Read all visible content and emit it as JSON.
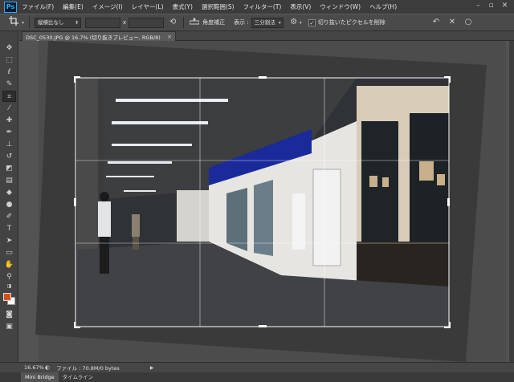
{
  "app": {
    "logo": "Ps"
  },
  "menu": [
    "ファイル(F)",
    "編集(E)",
    "イメージ(I)",
    "レイヤー(L)",
    "書式(Y)",
    "選択範囲(S)",
    "フィルター(T)",
    "表示(V)",
    "ウィンドウ(W)",
    "ヘルプ(H)"
  ],
  "window_controls": {
    "minimize": "–",
    "restore": "▫",
    "close": "✕"
  },
  "options": {
    "ratio_select": "縦横比なし",
    "swap_symbol": "x",
    "straighten_label": "角度補正",
    "view_label": "表示 :",
    "view_select": "三分割法",
    "delete_pixels_label": "切り抜いたピクセルを削除",
    "delete_pixels_checked": true
  },
  "document": {
    "tab_title": "DSC_0530.JPG @ 16.7% (切り抜きプレビュー, RGB/8)",
    "close_symbol": "×"
  },
  "status": {
    "zoom": "16.67%",
    "file_info": "ファイル : 70.8M/0 bytes"
  },
  "bottom_tabs": [
    "Mini Bridge",
    "タイムライン"
  ],
  "colors": {
    "foreground": "#d4501c",
    "background": "#ffffff",
    "accent": "#3aa8f0"
  },
  "icons": {
    "crop_tool": "crop-icon",
    "straighten": "level-icon",
    "settings": "gear-icon",
    "reset": "undo-icon",
    "cancel": "cancel-icon",
    "commit": "commit-circle-icon"
  }
}
